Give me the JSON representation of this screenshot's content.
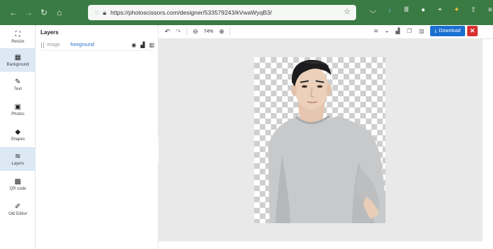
{
  "browser": {
    "url": "https://photoscissors.com/designer/533579243/kVwaWyqB3/",
    "nav_icons": [
      "back-icon",
      "forward-icon",
      "reload-icon",
      "home-icon"
    ],
    "chrome_color": "#3a7a43"
  },
  "rail": {
    "items": [
      {
        "label": "Resize",
        "icon": "⛶"
      },
      {
        "label": "Background",
        "icon": "▦"
      },
      {
        "label": "Text",
        "icon": "✎"
      },
      {
        "label": "Photos",
        "icon": "▣"
      },
      {
        "label": "Shapes",
        "icon": "◆"
      },
      {
        "label": "Layers",
        "icon": "≋"
      },
      {
        "label": "QR code",
        "icon": "▩"
      },
      {
        "label": "Old Editor",
        "icon": "✐"
      }
    ]
  },
  "layers": {
    "title": "Layers",
    "rows": [
      {
        "type": "image",
        "name": "foreground"
      }
    ]
  },
  "toolbar": {
    "zoom": "74%",
    "download_label": "Download",
    "close_label": "✕",
    "accent": "#1a6fd0",
    "danger": "#d9302f"
  }
}
